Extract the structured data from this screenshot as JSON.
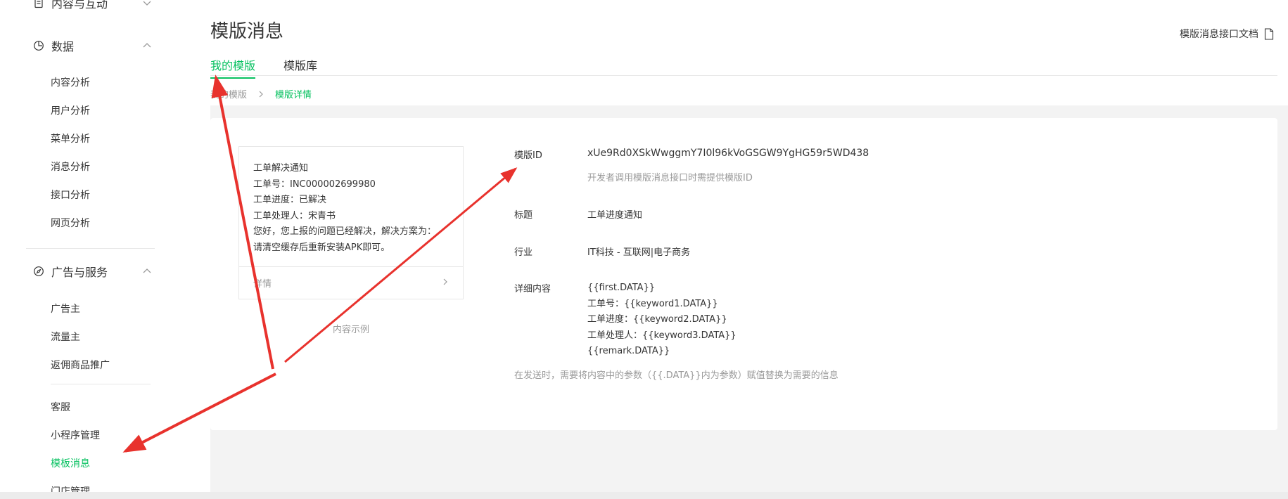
{
  "sidebar": {
    "partial_group": {
      "label": "内容与互动",
      "icon": "document-icon"
    },
    "data_group": {
      "label": "数据",
      "icon": "pie-chart-icon",
      "items": [
        "内容分析",
        "用户分析",
        "菜单分析",
        "消息分析",
        "接口分析",
        "网页分析"
      ]
    },
    "ads_group": {
      "label": "广告与服务",
      "icon": "compass-icon",
      "items": [
        "广告主",
        "流量主",
        "返佣商品推广"
      ]
    },
    "extra_items": [
      "客服",
      "小程序管理",
      "模板消息",
      "门店管理"
    ],
    "active_item": "模板消息"
  },
  "header": {
    "title": "模版消息",
    "doc_link": "模版消息接口文档",
    "tabs": [
      "我的模版",
      "模版库"
    ],
    "active_tab": "我的模版"
  },
  "breadcrumb": {
    "parent": "我的模版",
    "current": "模版详情"
  },
  "preview": {
    "lines": [
      "工单解决通知",
      "工单号：INC000002699980",
      "工单进度：已解决",
      "工单处理人：宋青书",
      "您好，您上报的问题已经解决，解决方案为：",
      "请清空缓存后重新安装APK即可。"
    ],
    "details_label": "详情",
    "caption": "内容示例"
  },
  "detail": {
    "template_id_label": "模版ID",
    "template_id": "xUe9Rd0XSkWwggmY7I0l96kVoGSGW9YgHG59r5WD438",
    "template_id_hint": "开发者调用模版消息接口时需提供模版ID",
    "title_label": "标题",
    "title_value": "工单进度通知",
    "industry_label": "行业",
    "industry_value": "IT科技 - 互联网|电子商务",
    "content_label": "详细内容",
    "content_lines": [
      "{{first.DATA}}",
      "工单号：{{keyword1.DATA}}",
      "工单进度：{{keyword2.DATA}}",
      "工单处理人：{{keyword3.DATA}}",
      "{{remark.DATA}}"
    ],
    "send_note": "在发送时，需要将内容中的参数（{{.DATA}}内为参数）赋值替换为需要的信息"
  },
  "colors": {
    "accent": "#07c160",
    "annotation_arrow": "#e8322d",
    "muted_text": "#9a9a9a",
    "page_background": "#f3f3f3"
  }
}
